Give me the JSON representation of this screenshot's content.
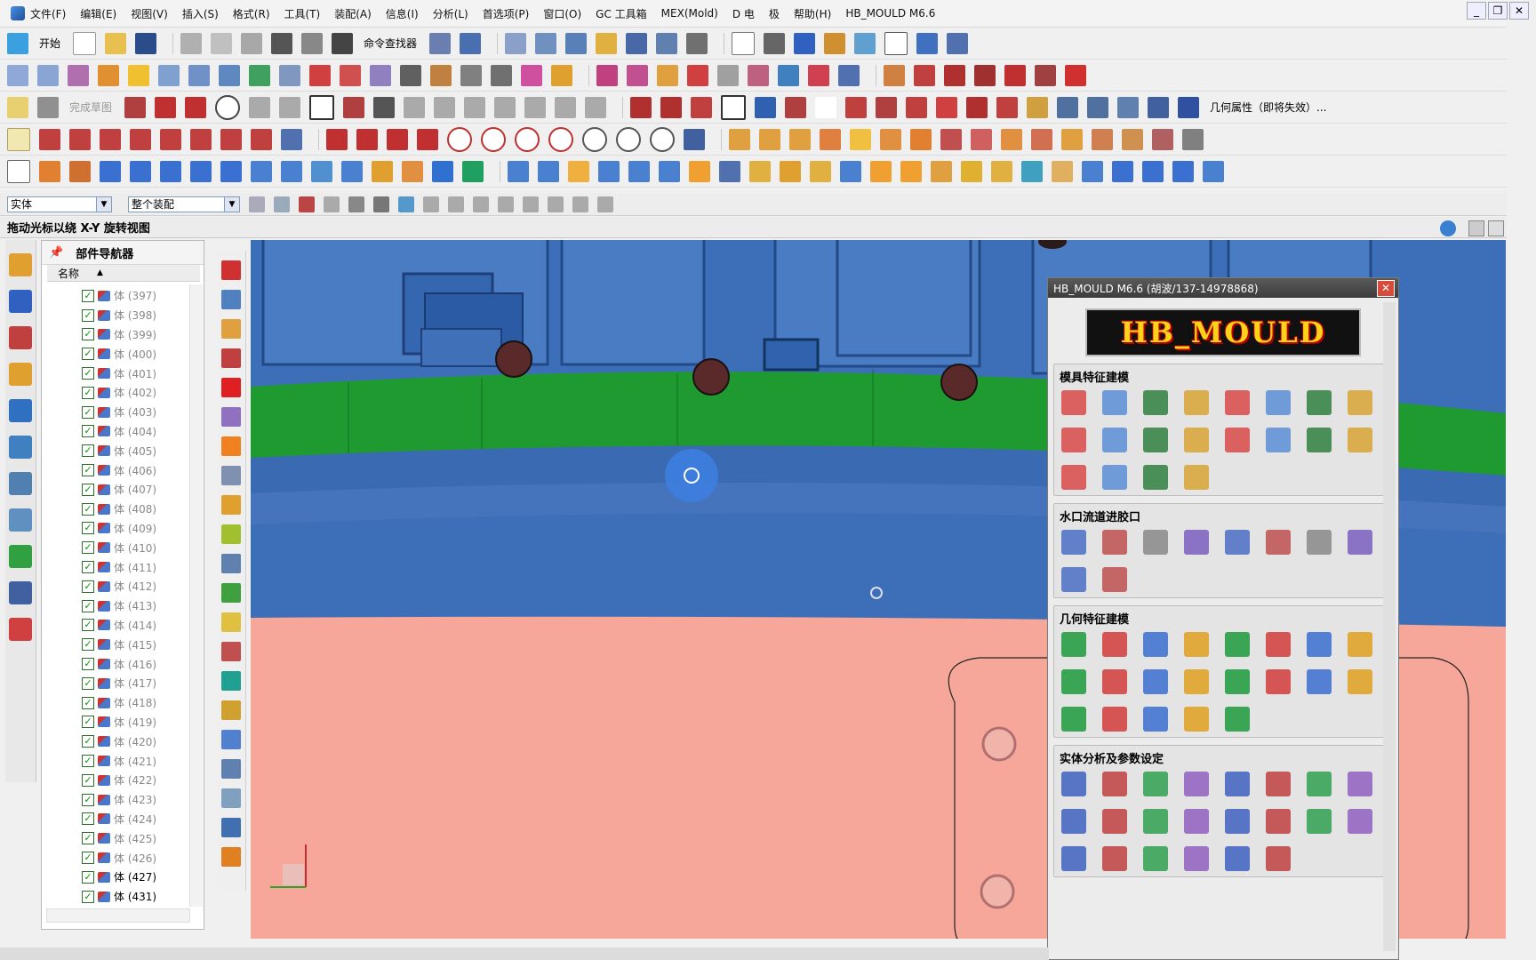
{
  "menubar": {
    "items": [
      "文件(F)",
      "编辑(E)",
      "视图(V)",
      "插入(S)",
      "格式(R)",
      "工具(T)",
      "装配(A)",
      "信息(I)",
      "分析(L)",
      "首选项(P)",
      "窗口(O)",
      "GC 工具箱",
      "MEX(Mold)",
      "D 电",
      "极",
      "帮助(H)",
      "HB_MOULD M6.6"
    ]
  },
  "toolbar1": {
    "start_label": "开始",
    "command_finder": "命令查找器"
  },
  "toolbar3": {
    "sketch_label": "完成草图",
    "geometry_attr": "几何属性（即将失效）..."
  },
  "selection": {
    "filter_value": "实体",
    "scope_value": "整个装配"
  },
  "cue": {
    "text": "拖动光标以绕 X-Y 旋转视图"
  },
  "navigator": {
    "title": "部件导航器",
    "column_name": "名称",
    "rows": [
      {
        "label": "体 (397)",
        "dark": false
      },
      {
        "label": "体 (398)",
        "dark": false
      },
      {
        "label": "体 (399)",
        "dark": false
      },
      {
        "label": "体 (400)",
        "dark": false
      },
      {
        "label": "体 (401)",
        "dark": false
      },
      {
        "label": "体 (402)",
        "dark": false
      },
      {
        "label": "体 (403)",
        "dark": false
      },
      {
        "label": "体 (404)",
        "dark": false
      },
      {
        "label": "体 (405)",
        "dark": false
      },
      {
        "label": "体 (406)",
        "dark": false
      },
      {
        "label": "体 (407)",
        "dark": false
      },
      {
        "label": "体 (408)",
        "dark": false
      },
      {
        "label": "体 (409)",
        "dark": false
      },
      {
        "label": "体 (410)",
        "dark": false
      },
      {
        "label": "体 (411)",
        "dark": false
      },
      {
        "label": "体 (412)",
        "dark": false
      },
      {
        "label": "体 (413)",
        "dark": false
      },
      {
        "label": "体 (414)",
        "dark": false
      },
      {
        "label": "体 (415)",
        "dark": false
      },
      {
        "label": "体 (416)",
        "dark": false
      },
      {
        "label": "体 (417)",
        "dark": false
      },
      {
        "label": "体 (418)",
        "dark": false
      },
      {
        "label": "体 (419)",
        "dark": false
      },
      {
        "label": "体 (420)",
        "dark": false
      },
      {
        "label": "体 (421)",
        "dark": false
      },
      {
        "label": "体 (422)",
        "dark": false
      },
      {
        "label": "体 (423)",
        "dark": false
      },
      {
        "label": "体 (424)",
        "dark": false
      },
      {
        "label": "体 (425)",
        "dark": false
      },
      {
        "label": "体 (426)",
        "dark": false
      },
      {
        "label": "体 (427)",
        "dark": true
      },
      {
        "label": "体 (431)",
        "dark": true
      }
    ]
  },
  "panel": {
    "title": "HB_MOULD M6.6 (胡波/137-14978868)",
    "close": "✕",
    "logo_text": "HB_MOULD",
    "groups": [
      {
        "title": "模具特征建模",
        "count": 20,
        "colors": [
          "#d94a4a",
          "#5b8ed6",
          "#2f7f3f",
          "#d8a534"
        ]
      },
      {
        "title": "水口流道进胶口",
        "count": 10,
        "colors": [
          "#4a6fc4",
          "#c05050",
          "#888888",
          "#7a5fc0"
        ]
      },
      {
        "title": "几何特征建模",
        "count": 21,
        "colors": [
          "#1c9b3c",
          "#d23b3b",
          "#3a6fd0",
          "#e0a020"
        ]
      },
      {
        "title": "实体分析及参数设定",
        "count": 22,
        "colors": [
          "#4060c0",
          "#c04040",
          "#30a050",
          "#9060c0"
        ]
      }
    ]
  },
  "icons": {
    "menu_app": "nx-app-icon",
    "res_bar": [
      "assembly-nav-icon",
      "constraint-nav-icon",
      "part-nav-icon",
      "reuse-library-icon",
      "hd3d-tools-icon",
      "web-browser-icon",
      "history-icon",
      "process-studio-icon",
      "manufacturing-wizard-icon",
      "roles-icon",
      "system-materials-icon"
    ]
  },
  "colors": {
    "viewport_blue": "#3c6fb8",
    "viewport_green": "#1f9a30",
    "viewport_salmon": "#f6a79a",
    "panel_title": "#4a4a4a",
    "logo_text": "#ffd21a"
  }
}
